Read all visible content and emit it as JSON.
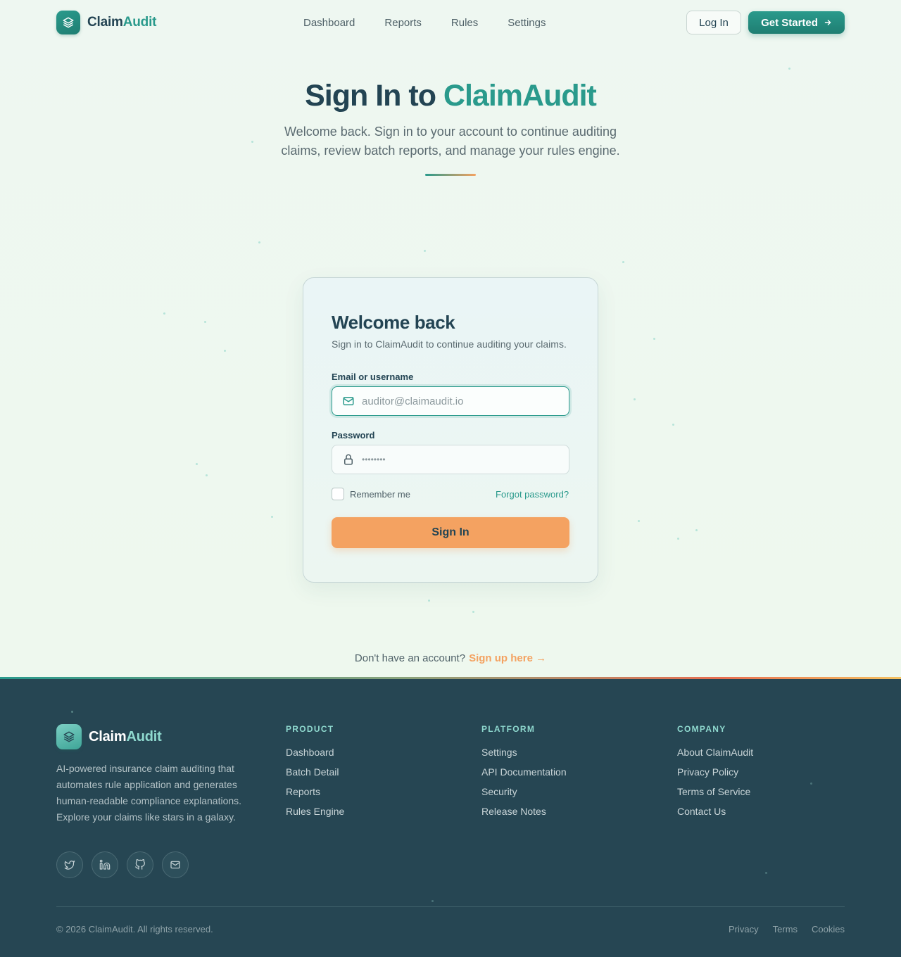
{
  "brand": {
    "name_part1": "Claim",
    "name_part2": "Audit"
  },
  "nav": {
    "items": [
      "Dashboard",
      "Reports",
      "Rules",
      "Settings"
    ]
  },
  "header": {
    "login_label": "Log In",
    "get_started_label": "Get Started"
  },
  "hero": {
    "title_part1": "Sign In to",
    "title_part2": "ClaimAudit",
    "subtitle": "Welcome back. Sign in to your account to continue auditing claims, review batch reports, and manage your rules engine."
  },
  "login": {
    "title": "Welcome back",
    "subtitle": "Sign in to ClaimAudit to continue auditing your claims.",
    "email_label": "Email or username",
    "email_placeholder": "auditor@claimaudit.io",
    "password_label": "Password",
    "password_placeholder": "••••••••",
    "remember_label": "Remember me",
    "forgot_label": "Forgot password?",
    "submit_label": "Sign In"
  },
  "signup": {
    "prompt": "Don't have an account?",
    "link_label": "Sign up here →"
  },
  "footer": {
    "description": "AI-powered insurance claim auditing that automates rule application and generates human-readable compliance explanations. Explore your claims like stars in a galaxy.",
    "social_icons": [
      "twitter-icon",
      "linkedin-icon",
      "github-icon",
      "mail-icon"
    ],
    "columns": [
      {
        "title": "PRODUCT",
        "links": [
          "Dashboard",
          "Batch Detail",
          "Reports",
          "Rules Engine"
        ]
      },
      {
        "title": "PLATFORM",
        "links": [
          "Settings",
          "API Documentation",
          "Security",
          "Release Notes"
        ]
      },
      {
        "title": "COMPANY",
        "links": [
          "About ClaimAudit",
          "Privacy Policy",
          "Terms of Service",
          "Contact Us"
        ]
      }
    ],
    "copyright": "© 2026 ClaimAudit. All rights reserved.",
    "legal_links": [
      "Privacy",
      "Terms",
      "Cookies"
    ]
  },
  "colors": {
    "primary": "#2a9a8c",
    "accent": "#f4a261",
    "dark": "#264653",
    "background": "#eef7f1"
  }
}
